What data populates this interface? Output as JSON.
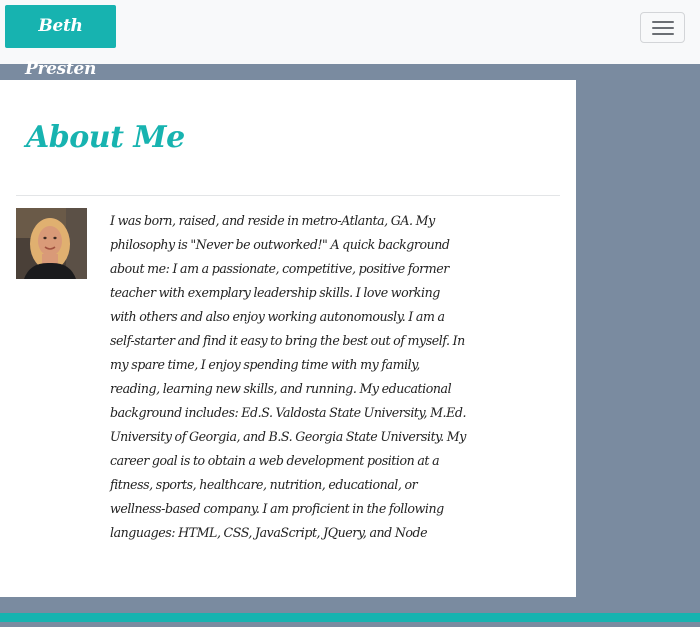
{
  "navbar": {
    "brand": "Beth Presten",
    "toggler_icon": "hamburger-menu-icon"
  },
  "about": {
    "title": "About Me",
    "photo": "profile-photo",
    "bio": "I was born, raised, and reside in metro-Atlanta, GA. My philosophy is \"Never be outworked!\" A quick background about me: I am a passionate, competitive, positive former teacher with exemplary leadership skills. I love working with others and also enjoy working autonomously. I am a self-starter and find it easy to bring the best out of myself. In my spare time, I enjoy spending time with my family, reading, learning new skills, and running. My educational background includes: Ed.S. Valdosta State University, M.Ed. University of Georgia, and B.S. Georgia State University. My career goal is to obtain a web development position at a fitness, sports, healthcare, nutrition, educational, or wellness-based company. I am proficient in the following languages: HTML, CSS, JavaScript, JQuery, and Node"
  },
  "colors": {
    "accent": "#17b3b0",
    "page_background": "#7a8ba0",
    "navbar_background": "#f8f9fa",
    "card_background": "#ffffff"
  }
}
